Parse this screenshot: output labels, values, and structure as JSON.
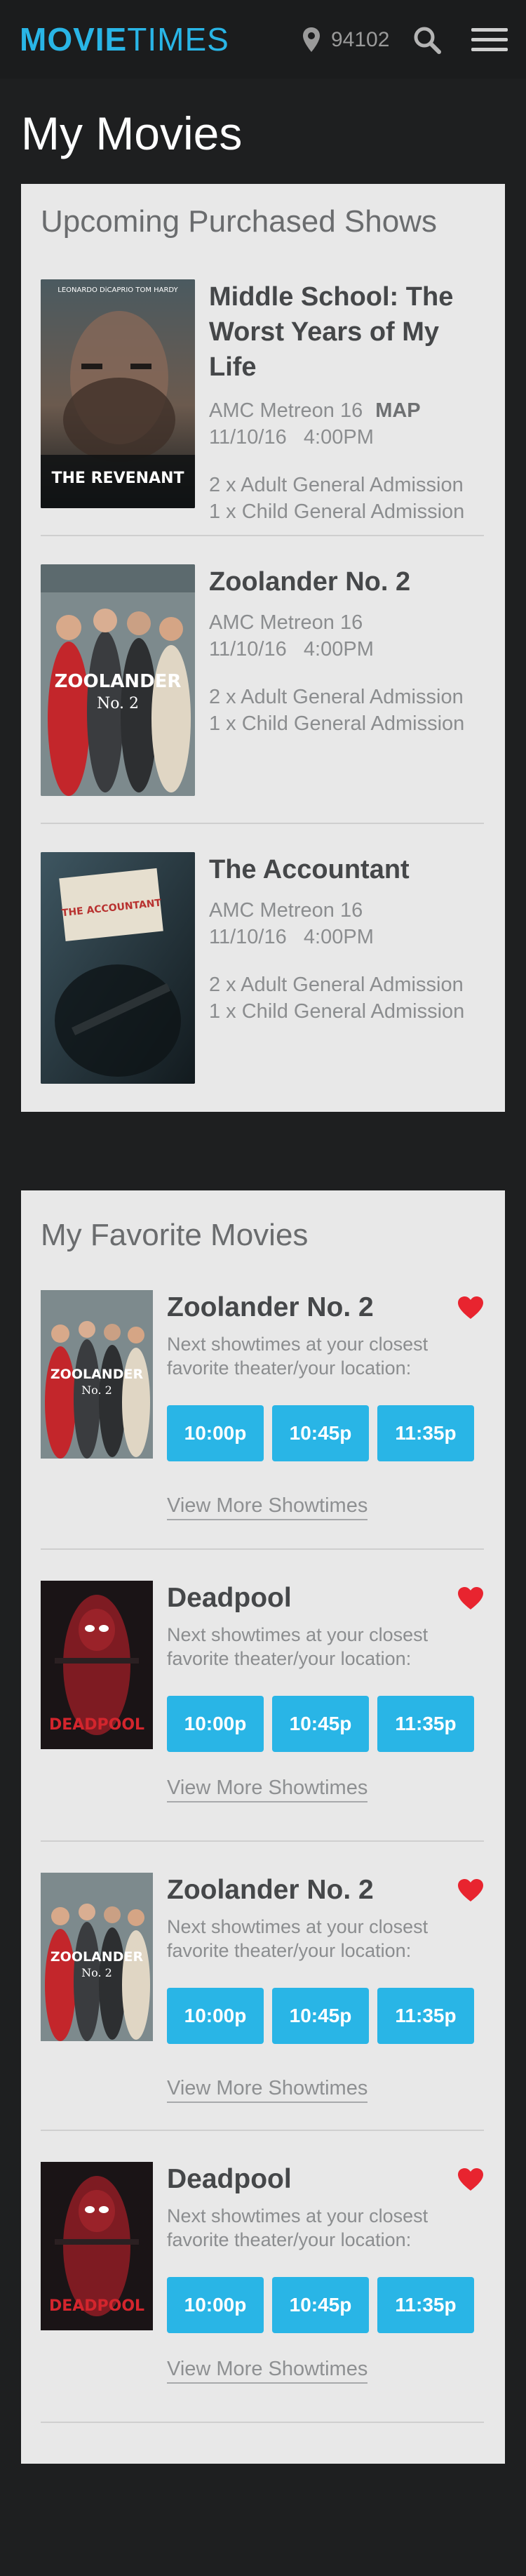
{
  "header": {
    "logo_bold": "MOVIE",
    "logo_thin": "TIMES",
    "zip": "94102",
    "icons": [
      "location-pin-icon",
      "search-icon",
      "hamburger-menu-icon"
    ]
  },
  "page_title": "My Movies",
  "purchased": {
    "title": "Upcoming Purchased Shows",
    "map_label": "MAP",
    "shows": [
      {
        "title": "Middle School: The Worst Years of My Life",
        "theater": "AMC Metreon 16",
        "date": "11/10/16",
        "time": "4:00PM",
        "tickets": [
          "2 x Adult General Admission",
          "1 x Child General Admission"
        ],
        "poster_text": "THE REVENANT",
        "poster_top": "LEONARDO DiCAPRIO   TOM HARDY"
      },
      {
        "title": "Zoolander No. 2",
        "theater": "AMC Metreon 16",
        "date": "11/10/16",
        "time": "4:00PM",
        "tickets": [
          "2 x Adult General Admission",
          "1 x Child General Admission"
        ],
        "poster_text": "ZOOLANDER",
        "poster_sub": "No. 2"
      },
      {
        "title": "The Accountant",
        "theater": "AMC Metreon 16",
        "date": "11/10/16",
        "time": "4:00PM",
        "tickets": [
          "2 x Adult General Admission",
          "1 x Child General Admission"
        ],
        "poster_text": "THE ACCOUNTANT"
      }
    ]
  },
  "favorites": {
    "title": "My Favorite Movies",
    "desc": "Next showtimes at your closest favorite theater/your location:",
    "more_label": "View More Showtimes",
    "items": [
      {
        "title": "Zoolander No. 2",
        "poster_text": "ZOOLANDER",
        "poster_sub": "No. 2",
        "times": [
          "10:00p",
          "10:45p",
          "11:35p"
        ]
      },
      {
        "title": "Deadpool",
        "poster_text": "DEADPOOL",
        "times": [
          "10:00p",
          "10:45p",
          "11:35p"
        ]
      },
      {
        "title": "Zoolander No. 2",
        "poster_text": "ZOOLANDER",
        "poster_sub": "No. 2",
        "times": [
          "10:00p",
          "10:45p",
          "11:35p"
        ]
      },
      {
        "title": "Deadpool",
        "poster_text": "DEADPOOL",
        "times": [
          "10:00p",
          "10:45p",
          "11:35p"
        ]
      }
    ]
  },
  "colors": {
    "accent": "#29b5e6",
    "heart": "#e8242f",
    "background": "#1e1f20",
    "card": "#e8e8e8"
  }
}
